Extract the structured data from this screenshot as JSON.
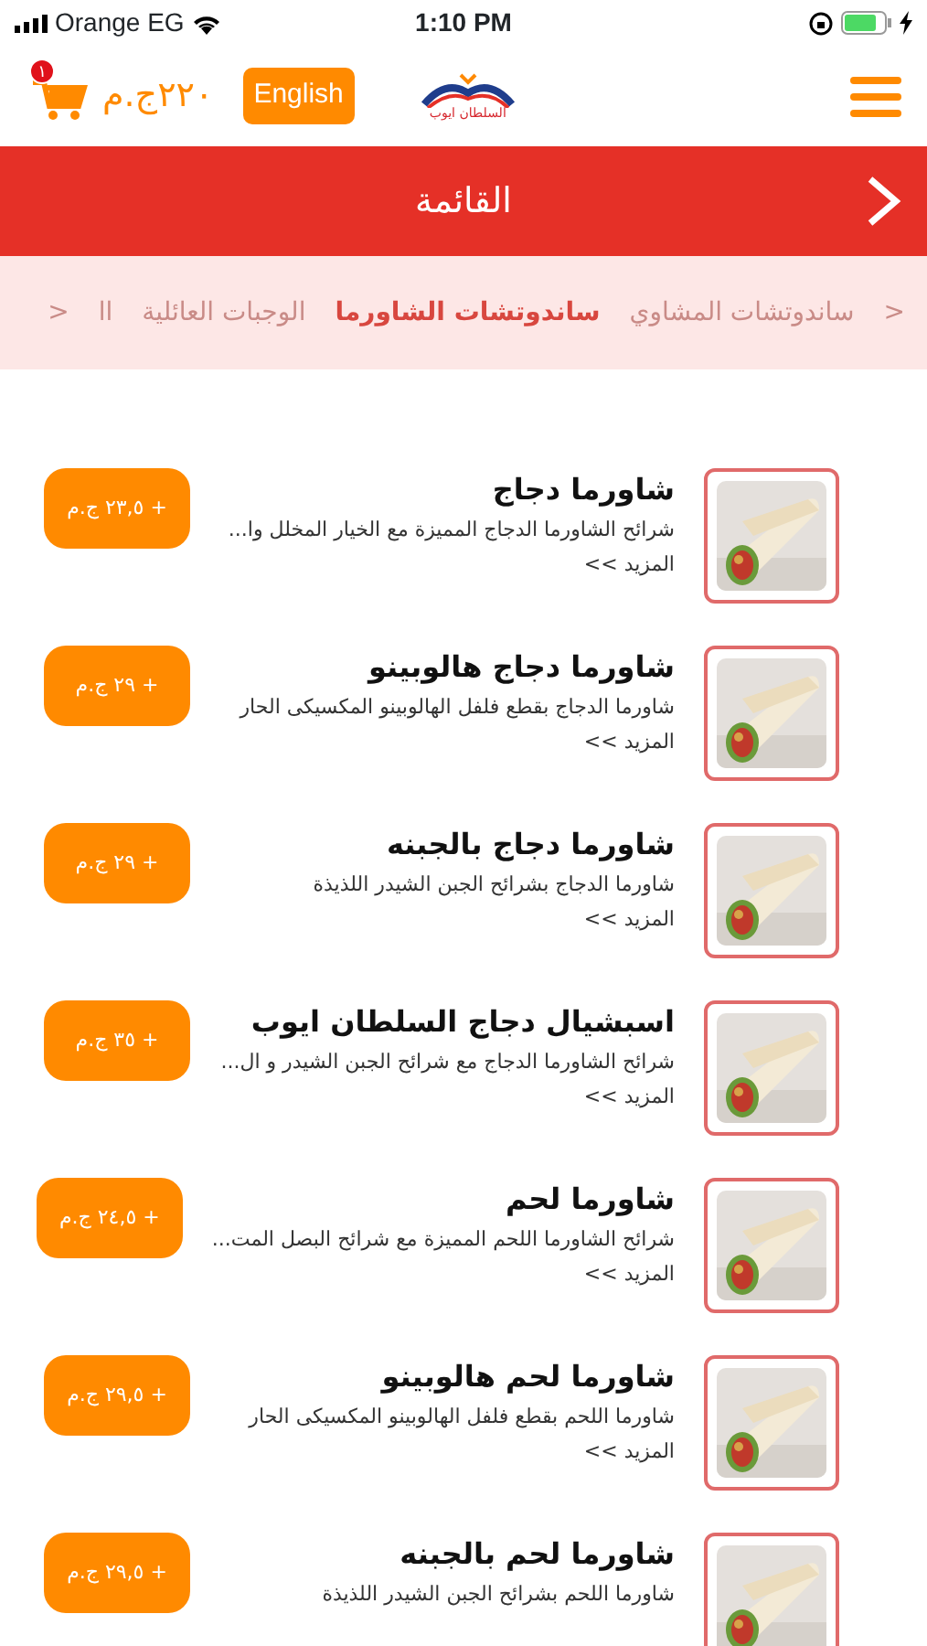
{
  "status_bar": {
    "carrier": "Orange EG",
    "time": "1:10 PM"
  },
  "header": {
    "cart_badge": "١",
    "cart_total": "٢٢٠ج.م",
    "language_button": "English",
    "logo_text": "السلطان ايوب"
  },
  "title_bar": {
    "title": "القائمة"
  },
  "category_tabs": {
    "prev": "<",
    "next": "<",
    "tabs": [
      {
        "label": "ساندوتشات المشاوي",
        "selected": false
      },
      {
        "label": "ساندوتشات الشاورما",
        "selected": true
      },
      {
        "label": "الوجبات العائلية",
        "selected": false
      },
      {
        "label": "اا",
        "selected": false
      }
    ]
  },
  "items": [
    {
      "name": "شاورما دجاج",
      "description": "شرائح الشاورما الدجاج المميزة مع الخيار المخلل وا...",
      "more": "المزيد >>",
      "price": "+ ٢٣,٥ ج.م"
    },
    {
      "name": "شاورما دجاج هالوبينو",
      "description": "شاورما الدجاج بقطع فلفل الهالوبينو المكسيكى الحار",
      "more": "المزيد >>",
      "price": "+ ٢٩ ج.م"
    },
    {
      "name": "شاورما دجاج بالجبنه",
      "description": "شاورما الدجاج بشرائح الجبن الشيدر اللذيذة",
      "more": "المزيد >>",
      "price": "+ ٢٩ ج.م"
    },
    {
      "name": "اسبشيال دجاج السلطان ايوب",
      "description": "شرائح الشاورما الدجاج مع شرائح الجبن الشيدر و ال...",
      "more": "المزيد >>",
      "price": "+ ٣٥ ج.م"
    },
    {
      "name": "شاورما لحم",
      "description": "شرائح الشاورما اللحم المميزة مع شرائح البصل المت...",
      "more": "المزيد >>",
      "price": "+ ٢٤,٥ ج.م"
    },
    {
      "name": "شاورما لحم هالوبينو",
      "description": "شاورما اللحم بقطع فلفل الهالوبينو المكسيكى الحار",
      "more": "المزيد >>",
      "price": "+ ٢٩,٥ ج.م"
    },
    {
      "name": "شاورما لحم بالجبنه",
      "description": "شاورما اللحم بشرائح الجبن الشيدر اللذيذة",
      "price": "+ ٢٩,٥ ج.م"
    }
  ]
}
